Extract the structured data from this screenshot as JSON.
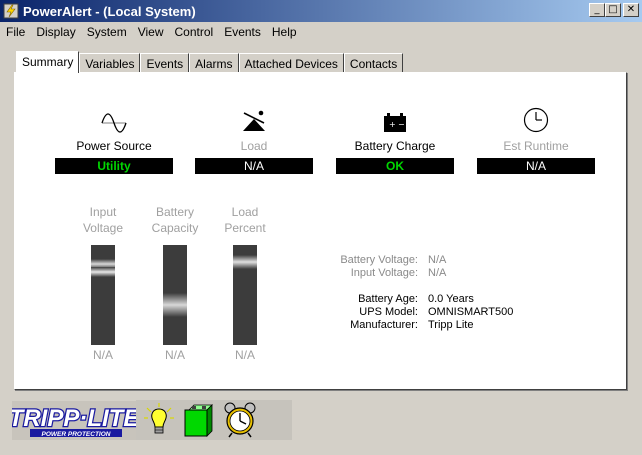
{
  "window": {
    "title": "PowerAlert - (Local System)"
  },
  "titlebar": {
    "minimize_glyph": "_",
    "maximize_glyph": "□",
    "close_glyph": "✕"
  },
  "menu": [
    "File",
    "Display",
    "System",
    "View",
    "Control",
    "Events",
    "Help"
  ],
  "tabs": [
    "Summary",
    "Variables",
    "Events",
    "Alarms",
    "Attached Devices",
    "Contacts"
  ],
  "status": {
    "power_source": {
      "label": "Power Source",
      "value": "Utility",
      "icon": "sine-wave-icon"
    },
    "load": {
      "label": "Load",
      "value": "N/A",
      "icon": "scale-icon"
    },
    "battery_charge": {
      "label": "Battery Charge",
      "value": "OK",
      "icon": "battery-icon"
    },
    "runtime": {
      "label": "Est Runtime",
      "value": "N/A",
      "icon": "clock-icon"
    }
  },
  "gauges": {
    "input_voltage": {
      "line1": "Input",
      "line2": "Voltage",
      "value": "N/A"
    },
    "battery_capacity": {
      "line1": "Battery",
      "line2": "Capacity",
      "value": "N/A"
    },
    "load_percent": {
      "line1": "Load",
      "line2": "Percent",
      "value": "N/A"
    }
  },
  "info": {
    "battery_voltage": {
      "label": "Battery Voltage:",
      "value": "N/A"
    },
    "input_voltage": {
      "label": "Input Voltage:",
      "value": "N/A"
    },
    "battery_age": {
      "label": "Battery Age:",
      "value": "0.0 Years"
    },
    "ups_model": {
      "label": "UPS Model:",
      "value": "OMNISMART500"
    },
    "manufacturer": {
      "label": "Manufacturer:",
      "value": "Tripp Lite"
    }
  },
  "brand": {
    "name": "TRIPP·LITE",
    "tagline": "POWER PROTECTION"
  },
  "colors": {
    "ok_green": "#00d800",
    "title_blue": "#0a246a"
  }
}
